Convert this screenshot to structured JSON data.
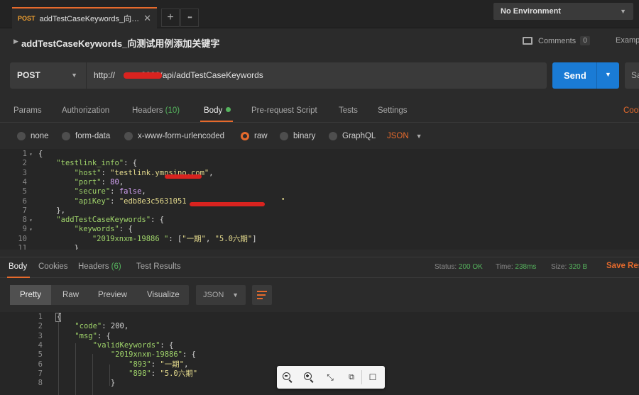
{
  "tab": {
    "method": "POST",
    "name": "addTestCaseKeywords_向测试用例添加关键字",
    "close": "✕"
  },
  "tabstrip": {
    "add": "+",
    "more": "•••"
  },
  "environment": {
    "label": "No Environment"
  },
  "title": {
    "text": "addTestCaseKeywords_向测试用例添加关键字"
  },
  "comments": {
    "label": "Comments",
    "count": "0"
  },
  "examples": {
    "label": "Examples"
  },
  "request": {
    "method": "POST",
    "url": "http://          :8020/api/addTestCaseKeywords",
    "send_label": "Send",
    "save_label": "Save"
  },
  "request_tabs": {
    "params": "Params",
    "authorization": "Authorization",
    "headers": "Headers",
    "headers_count": "(10)",
    "body": "Body",
    "prerequest": "Pre-request Script",
    "tests": "Tests",
    "settings": "Settings",
    "cookies": "Cookies"
  },
  "body_types": {
    "none": "none",
    "form_data": "form-data",
    "urlencoded": "x-www-form-urlencoded",
    "raw": "raw",
    "binary": "binary",
    "graphql": "GraphQL",
    "format": "JSON",
    "selected": "raw"
  },
  "request_body": [
    {
      "n": "1",
      "fold": "▾",
      "parts": [
        [
          "p",
          "{"
        ]
      ]
    },
    {
      "n": "2",
      "fold": "",
      "parts": [
        [
          "p",
          "    "
        ],
        [
          "k",
          "\"testlink_info\""
        ],
        [
          "p",
          ": {"
        ]
      ]
    },
    {
      "n": "3",
      "fold": "",
      "parts": [
        [
          "p",
          "        "
        ],
        [
          "k",
          "\"host\""
        ],
        [
          "p",
          ": "
        ],
        [
          "s",
          "\"testlink.ymnsino.com\""
        ],
        [
          "p",
          ","
        ]
      ]
    },
    {
      "n": "4",
      "fold": "",
      "parts": [
        [
          "p",
          "        "
        ],
        [
          "k",
          "\"port\""
        ],
        [
          "p",
          ": "
        ],
        [
          "n",
          "80"
        ],
        [
          "p",
          ","
        ]
      ]
    },
    {
      "n": "5",
      "fold": "",
      "parts": [
        [
          "p",
          "        "
        ],
        [
          "k",
          "\"secure\""
        ],
        [
          "p",
          ": "
        ],
        [
          "n",
          "false"
        ],
        [
          "p",
          ","
        ]
      ]
    },
    {
      "n": "6",
      "fold": "",
      "parts": [
        [
          "p",
          "        "
        ],
        [
          "k",
          "\"apiKey\""
        ],
        [
          "p",
          ": "
        ],
        [
          "s",
          "\"edb8e3c5631051"
        ],
        [
          "s",
          "                     \""
        ]
      ]
    },
    {
      "n": "7",
      "fold": "",
      "parts": [
        [
          "p",
          "    },"
        ]
      ]
    },
    {
      "n": "8",
      "fold": "▾",
      "parts": [
        [
          "p",
          "    "
        ],
        [
          "k",
          "\"addTestCaseKeywords\""
        ],
        [
          "p",
          ": {"
        ]
      ]
    },
    {
      "n": "9",
      "fold": "▾",
      "parts": [
        [
          "p",
          "        "
        ],
        [
          "k",
          "\"keywords\""
        ],
        [
          "p",
          ": {"
        ]
      ]
    },
    {
      "n": "10",
      "fold": "",
      "parts": [
        [
          "p",
          "            "
        ],
        [
          "k",
          "\"2019xnxm-19886 \""
        ],
        [
          "p",
          ": ["
        ],
        [
          "s",
          "\"一期\""
        ],
        [
          "p",
          ", "
        ],
        [
          "s",
          "\"5.0六期\""
        ],
        [
          "p",
          "]"
        ]
      ]
    },
    {
      "n": "11",
      "fold": "",
      "parts": [
        [
          "p",
          "        }"
        ]
      ]
    }
  ],
  "response_tabs": {
    "body": "Body",
    "cookies": "Cookies",
    "headers": "Headers",
    "headers_count": "(6)",
    "test_results": "Test Results"
  },
  "response_meta": {
    "status_label": "Status:",
    "status_value": "200 OK",
    "time_label": "Time:",
    "time_value": "238ms",
    "size_label": "Size:",
    "size_value": "320 B",
    "save_response": "Save Response"
  },
  "response_views": {
    "pretty": "Pretty",
    "raw": "Raw",
    "preview": "Preview",
    "visualize": "Visualize",
    "format": "JSON"
  },
  "response_body": [
    {
      "n": "1",
      "parts": [
        [
          "p",
          "{"
        ]
      ]
    },
    {
      "n": "2",
      "parts": [
        [
          "p",
          "    "
        ],
        [
          "k",
          "\"code\""
        ],
        [
          "p",
          ": "
        ],
        [
          "p",
          "200,"
        ]
      ]
    },
    {
      "n": "3",
      "parts": [
        [
          "p",
          "    "
        ],
        [
          "k",
          "\"msg\""
        ],
        [
          "p",
          ": {"
        ]
      ]
    },
    {
      "n": "4",
      "parts": [
        [
          "p",
          "        "
        ],
        [
          "k",
          "\"validKeywords\""
        ],
        [
          "p",
          ": {"
        ]
      ]
    },
    {
      "n": "5",
      "parts": [
        [
          "p",
          "            "
        ],
        [
          "k",
          "\"2019xnxm-19886\""
        ],
        [
          "p",
          ": {"
        ]
      ]
    },
    {
      "n": "6",
      "parts": [
        [
          "p",
          "                "
        ],
        [
          "k",
          "\"893\""
        ],
        [
          "p",
          ": "
        ],
        [
          "s",
          "\"一期\""
        ],
        [
          "p",
          ","
        ]
      ]
    },
    {
      "n": "7",
      "parts": [
        [
          "p",
          "                "
        ],
        [
          "k",
          "\"898\""
        ],
        [
          "p",
          ": "
        ],
        [
          "s",
          "\"5.0六期\""
        ]
      ]
    },
    {
      "n": "8",
      "parts": [
        [
          "p",
          "            }"
        ]
      ]
    }
  ],
  "icons": {
    "zoom_out": "zoom-out-icon",
    "zoom_in": "zoom-in-icon",
    "fit": "fit-screen-icon",
    "present": "present-icon",
    "comment": "comment-icon"
  },
  "colors": {
    "accent": "#e66a2c",
    "send": "#1a7bd5",
    "status_ok": "#55b35d",
    "redaction": "#d9231f"
  }
}
